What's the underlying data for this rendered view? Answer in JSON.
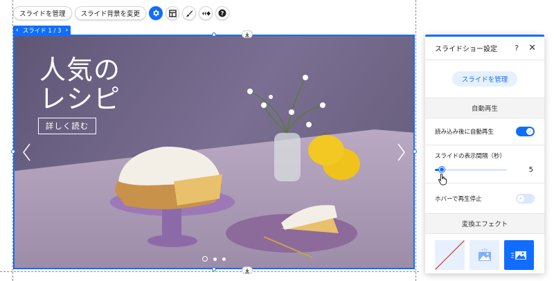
{
  "toolbar": {
    "manage_slides": "スライドを管理",
    "change_background": "スライド背景を変更",
    "icons": [
      "gear-icon",
      "layout-icon",
      "brush-icon",
      "animation-icon",
      "help-icon"
    ]
  },
  "slide_label": {
    "text": "スライド 1 / 3",
    "prev": "‹",
    "next": "›"
  },
  "slide": {
    "title_line1": "人気の",
    "title_line2": "レシピ",
    "cta": "詳しく読む",
    "dots_total": 3,
    "current_dot": 1
  },
  "panel": {
    "title": "スライドショー設定",
    "help": "?",
    "close": "✕",
    "manage_button": "スライドを管理",
    "autoplay_section": "自動再生",
    "autoplay_on_load_label": "読み込み後に自動再生",
    "autoplay_on_load": true,
    "interval_label": "スライドの表示間隔（秒）",
    "interval_value": "5",
    "interval_fraction": 0.1,
    "pause_on_hover_label": "ホバーで再生停止",
    "pause_on_hover": false,
    "effects_section": "変換エフェクト",
    "effects": [
      "none",
      "crossfade",
      "slide"
    ],
    "selected_effect": "slide"
  },
  "colors": {
    "accent": "#116dff",
    "accent_light": "#e7f0ff",
    "slide_background": "#6c6180"
  }
}
